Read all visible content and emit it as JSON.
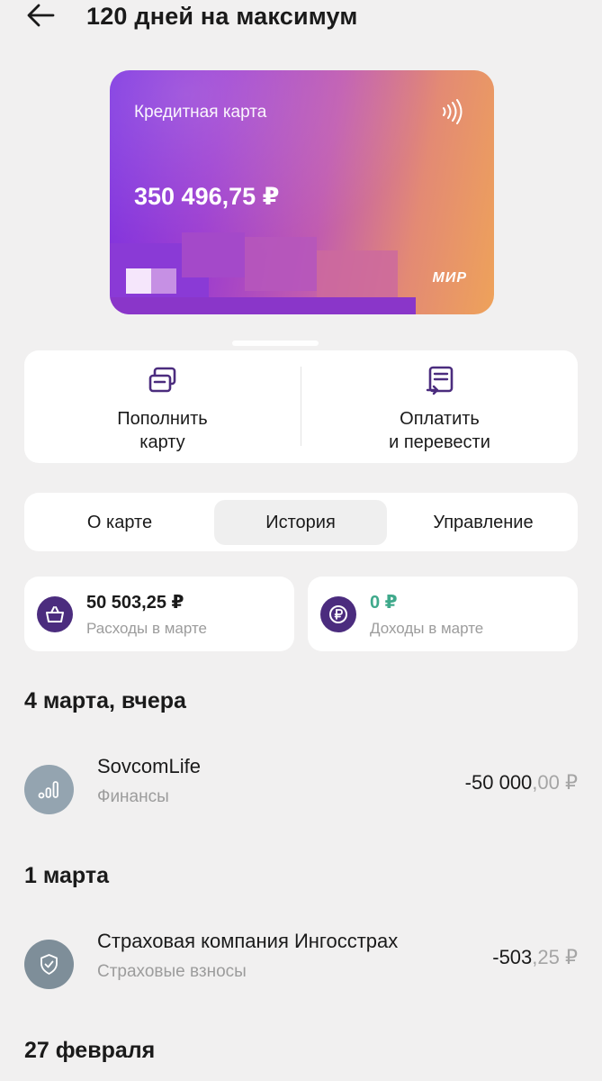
{
  "header": {
    "title": "120 дней на максимум"
  },
  "card": {
    "label": "Кредитная карта",
    "balance": "350 496,75 ₽",
    "payment_system": "МИР"
  },
  "actions": [
    {
      "label": "Пополнить\nкарту",
      "icon": "card-topup-icon"
    },
    {
      "label": "Оплатить\nи перевести",
      "icon": "pay-transfer-icon"
    }
  ],
  "tabs": [
    {
      "label": "О карте",
      "active": false
    },
    {
      "label": "История",
      "active": true
    },
    {
      "label": "Управление",
      "active": false
    }
  ],
  "summary": {
    "expenses": {
      "amount": "50 503,25 ₽",
      "caption": "Расходы в марте",
      "icon": "basket-icon"
    },
    "income": {
      "amount": "0 ₽",
      "caption": "Доходы в марте",
      "icon": "ruble-icon",
      "color": "#3fa98b"
    }
  },
  "history": [
    {
      "date": "4 марта, вчера",
      "transactions": [
        {
          "name": "SovcomLife",
          "category": "Финансы",
          "amount_int": "-50 000",
          "amount_frac": ",00 ₽",
          "icon": "bar-chart-icon"
        }
      ]
    },
    {
      "date": "1 марта",
      "transactions": [
        {
          "name": "Страховая компания Ингосстрах",
          "category": "Страховые взносы",
          "amount_int": "-503",
          "amount_frac": ",25 ₽",
          "icon": "shield-check-icon"
        }
      ]
    },
    {
      "date": "27 февраля",
      "transactions": []
    }
  ],
  "colors": {
    "background": "#f1f0f0",
    "accent_purple": "#4b2c7e",
    "income_green": "#3fa98b",
    "muted_text": "#9c9c9c"
  }
}
